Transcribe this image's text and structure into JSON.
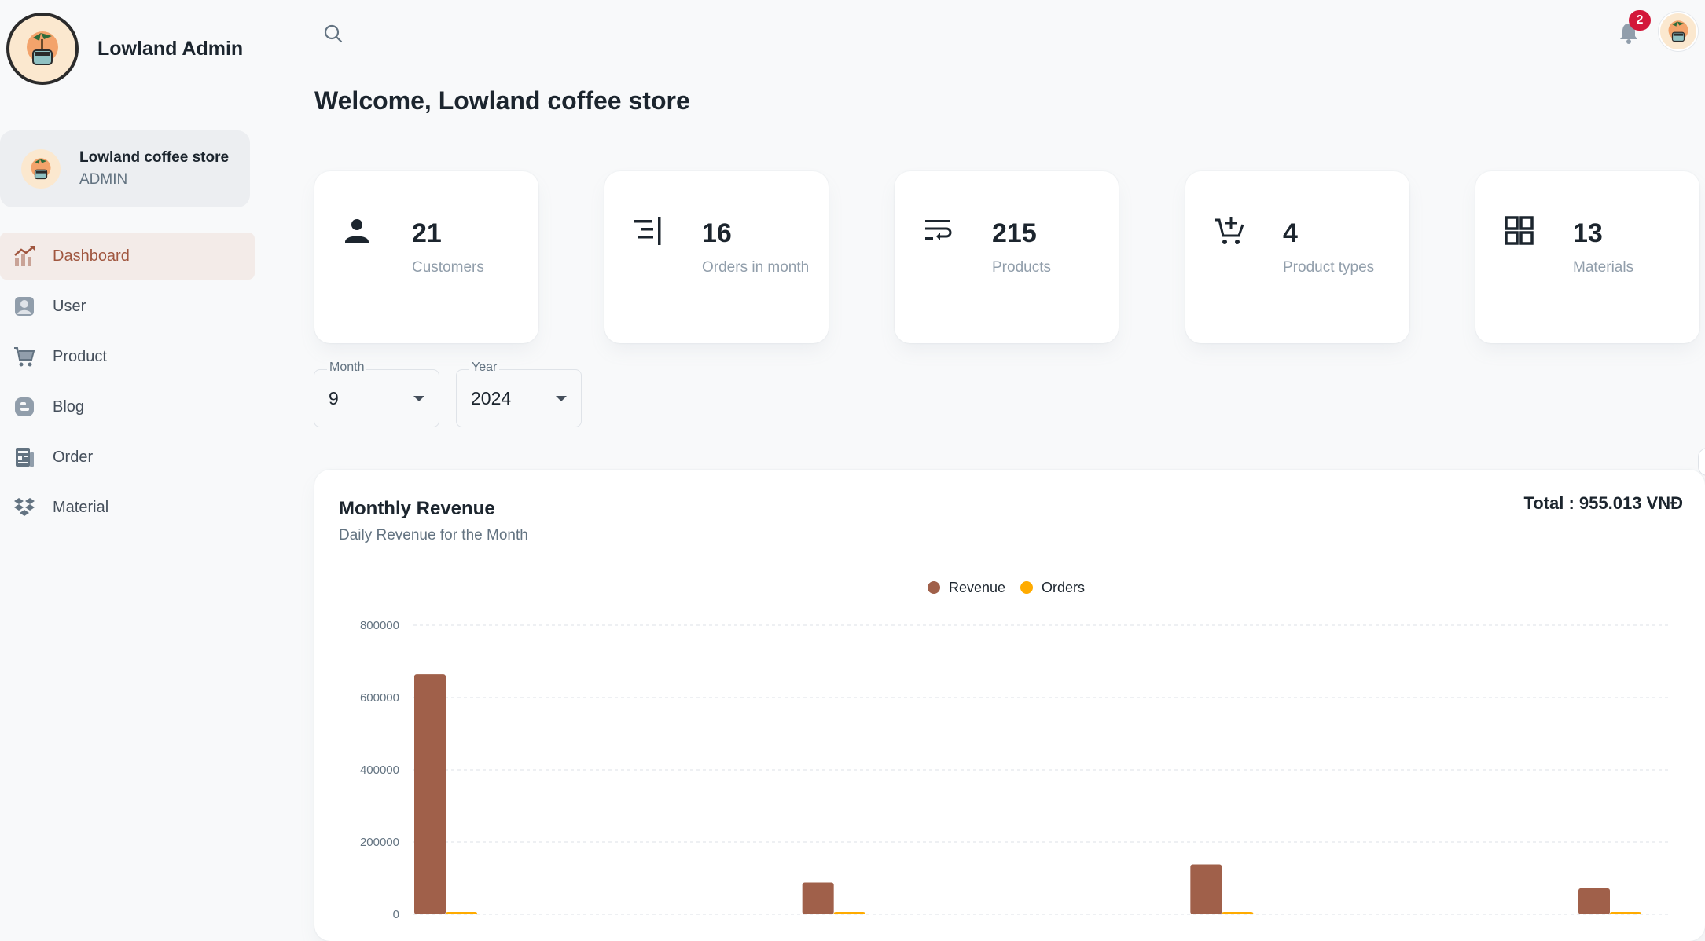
{
  "brand": {
    "title": "Lowland Admin"
  },
  "account": {
    "name": "Lowland coffee store",
    "role": "ADMIN"
  },
  "nav": {
    "items": [
      {
        "label": "Dashboard",
        "icon": "chart-icon",
        "active": true
      },
      {
        "label": "User",
        "icon": "user-icon"
      },
      {
        "label": "Product",
        "icon": "cart-icon"
      },
      {
        "label": "Blog",
        "icon": "blog-icon"
      },
      {
        "label": "Order",
        "icon": "order-icon"
      },
      {
        "label": "Material",
        "icon": "dropbox-icon"
      }
    ]
  },
  "header": {
    "notification_count": "2"
  },
  "page": {
    "title": "Welcome, Lowland coffee store"
  },
  "stats": [
    {
      "value": "21",
      "label": "Customers",
      "icon": "person-icon"
    },
    {
      "value": "16",
      "label": "Orders in month",
      "icon": "orders-icon"
    },
    {
      "value": "215",
      "label": "Products",
      "icon": "products-icon"
    },
    {
      "value": "4",
      "label": "Product types",
      "icon": "add-cart-icon"
    },
    {
      "value": "13",
      "label": "Materials",
      "icon": "grid-icon"
    }
  ],
  "filters": {
    "month": {
      "label": "Month",
      "value": "9"
    },
    "year": {
      "label": "Year",
      "value": "2024"
    }
  },
  "revenue": {
    "title": "Monthly Revenue",
    "subtitle": "Daily Revenue for the Month",
    "total": "Total : 955.013 VNĐ"
  },
  "colors": {
    "revenue": "#a0604a",
    "orders": "#ffab00",
    "accent": "#a0563f"
  },
  "chart_data": {
    "type": "bar",
    "categories": [
      "",
      "",
      "",
      ""
    ],
    "series": [
      {
        "name": "Revenue",
        "values": [
          665000,
          88000,
          138000,
          72000
        ]
      },
      {
        "name": "Orders",
        "values": [
          3,
          2,
          3,
          2
        ]
      }
    ],
    "ylim": [
      0,
      800000
    ],
    "yticks": [
      "800000",
      "600000",
      "400000",
      "200000",
      "0"
    ],
    "legend": "top-center",
    "grid": true
  }
}
